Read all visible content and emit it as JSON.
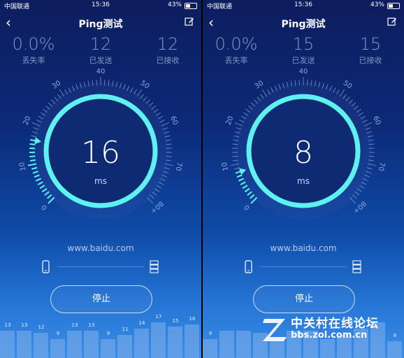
{
  "status_bar": {
    "carrier": "中国联通",
    "time": "15:36",
    "battery": "43%"
  },
  "theme": {
    "accent": "#5ff0f0",
    "tick_inactive": "#8fa6d8",
    "tick_active": "#5ff0f0"
  },
  "screens": [
    {
      "title": "Ping测试",
      "stats": [
        {
          "value": "0.0%",
          "label": "丢失率"
        },
        {
          "value": "12",
          "label": "已发送"
        },
        {
          "value": "12",
          "label": "已接收"
        }
      ],
      "dial": {
        "ticks": [
          "0",
          "10",
          "20",
          "30",
          "40",
          "50",
          "60",
          "70",
          "80+"
        ],
        "value": 16,
        "max": 80
      },
      "ms_value": "16",
      "ms_unit": "ms",
      "host": "www.baidu.com",
      "stop_label": "停止",
      "history": {
        "labels": [
          "13",
          "13",
          "12",
          "9",
          "13",
          "13",
          "9",
          "11",
          "14",
          "17",
          "15",
          "16"
        ],
        "values": [
          13,
          13,
          12,
          9,
          13,
          13,
          9,
          11,
          14,
          17,
          15,
          16
        ]
      }
    },
    {
      "title": "Ping测试",
      "stats": [
        {
          "value": "0.0%",
          "label": "丢失率"
        },
        {
          "value": "15",
          "label": "已发送"
        },
        {
          "value": "15",
          "label": "已接收"
        }
      ],
      "dial": {
        "ticks": [
          "0",
          "10",
          "20",
          "30",
          "40",
          "50",
          "60",
          "70",
          "80+"
        ],
        "value": 8,
        "max": 80
      },
      "ms_value": "8",
      "ms_unit": "ms",
      "host": "www.baidu.com",
      "stop_label": "停止",
      "history": {
        "labels": [
          "9",
          "",
          "",
          "",
          "",
          "",
          "",
          "",
          "",
          "",
          "",
          "8"
        ],
        "values": [
          9,
          13,
          13,
          12,
          9,
          13,
          13,
          9,
          11,
          14,
          17,
          8
        ]
      }
    }
  ],
  "watermark": {
    "brand": "中关村在线论坛",
    "url": "bbs.zol.com.cn"
  }
}
